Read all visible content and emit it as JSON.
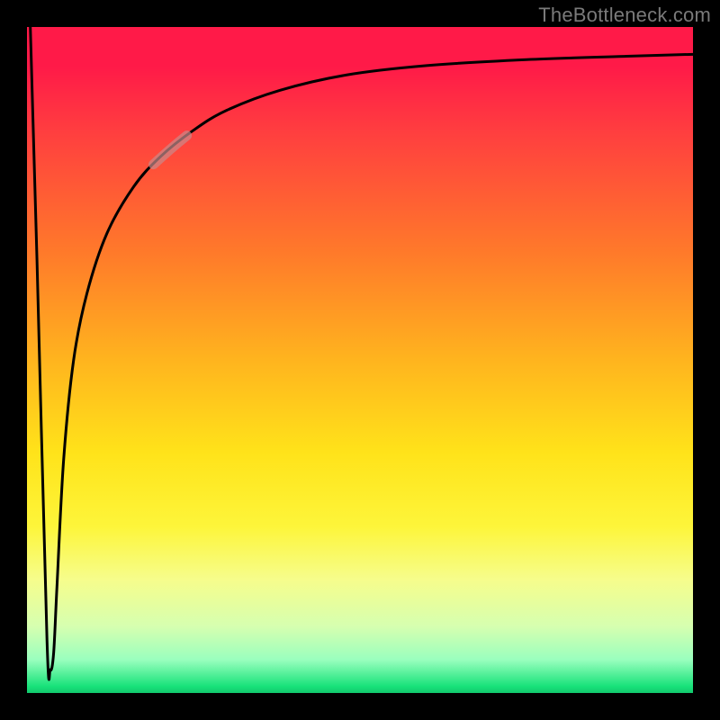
{
  "attribution": "TheBottleneck.com",
  "colors": {
    "frame": "#000000",
    "curve": "#000000",
    "highlight": "#c98a8aaa",
    "gradient_stops": [
      "#ff1a48",
      "#ff1a48",
      "#ff3f3f",
      "#ff7a2a",
      "#ffb41e",
      "#ffe31a",
      "#fdf53a",
      "#f6fd8c",
      "#d6ffb0",
      "#9affbe",
      "#18e27a",
      "#12c96d"
    ]
  },
  "chart_data": {
    "type": "line",
    "title": "",
    "xlabel": "",
    "ylabel": "",
    "xlim": [
      0,
      100
    ],
    "ylim": [
      0,
      100
    ],
    "grid": false,
    "legend": false,
    "note": "Axes are unlabeled; values below are read from pixel positions scaled to 0–100.",
    "highlight_segment_x": [
      19,
      24
    ],
    "series": [
      {
        "name": "curve",
        "x": [
          0.5,
          1.5,
          3.0,
          3.5,
          4.0,
          4.5,
          5.5,
          7.0,
          9.0,
          12.0,
          16.0,
          20.0,
          25.0,
          30.0,
          38.0,
          48.0,
          60.0,
          75.0,
          90.0,
          100.0
        ],
        "y": [
          100.0,
          65.0,
          8.0,
          3.5,
          6.0,
          16.0,
          35.0,
          50.0,
          60.0,
          69.0,
          76.0,
          80.5,
          84.5,
          87.5,
          90.5,
          92.8,
          94.2,
          95.1,
          95.6,
          95.9
        ]
      }
    ]
  }
}
